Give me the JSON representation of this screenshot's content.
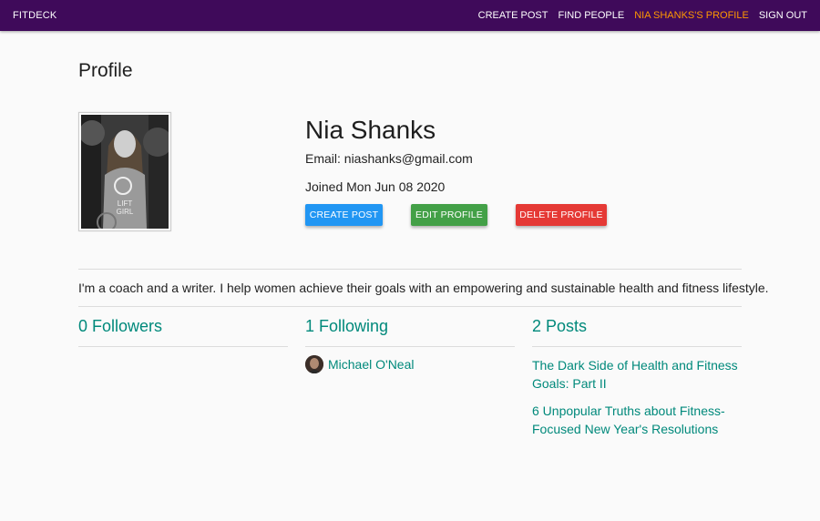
{
  "nav": {
    "brand": "FITDECK",
    "links": [
      {
        "label": "CREATE POST",
        "active": false
      },
      {
        "label": "FIND PEOPLE",
        "active": false
      },
      {
        "label": "NIA SHANKS'S PROFILE",
        "active": true
      },
      {
        "label": "SIGN OUT",
        "active": false
      }
    ],
    "active_color": "#ff9800",
    "bar_color": "#3f0a5a"
  },
  "page": {
    "title": "Profile"
  },
  "profile": {
    "photo_icon": "profile-photo",
    "name": "Nia Shanks",
    "email": "Email: niashanks@gmail.com",
    "joined": "Joined Mon Jun 08 2020",
    "buttons": {
      "create": "CREATE POST",
      "edit": "EDIT PROFILE",
      "delete": "DELETE PROFILE"
    },
    "bio": "I'm a coach and a writer. I help women achieve their goals with an empowering and sustainable health and fitness lifestyle."
  },
  "followers": {
    "title": "0 Followers",
    "items": []
  },
  "following": {
    "title": "1 Following",
    "items": [
      {
        "name": "Michael O'Neal"
      }
    ]
  },
  "posts": {
    "title": "2 Posts",
    "items": [
      {
        "title": "The Dark Side of Health and Fitness Goals: Part II"
      },
      {
        "title": "6 Unpopular Truths about Fitness-Focused New Year's Resolutions"
      }
    ]
  },
  "colors": {
    "accent": "#00897b",
    "create": "#2196f3",
    "edit": "#43a047",
    "delete": "#e53935"
  }
}
